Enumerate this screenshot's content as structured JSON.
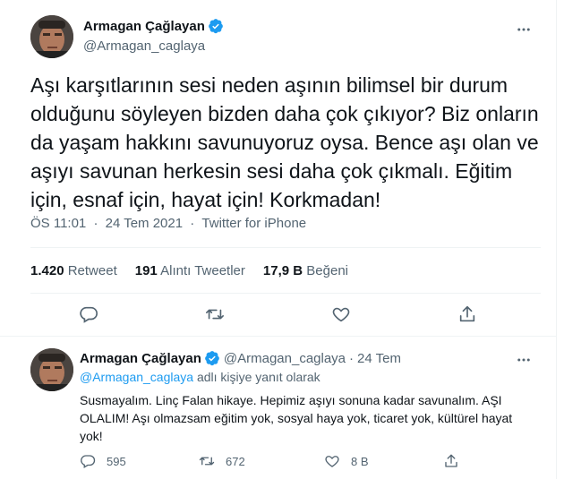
{
  "main_tweet": {
    "author_name": "Armagan Çağlayan",
    "author_handle": "@Armagan_caglaya",
    "text": "Aşı karşıtlarının sesi neden aşının bilimsel bir durum olduğunu söyleyen bizden daha çok çıkıyor? Biz onların da yaşam hakkını savunuyoruz oysa. Bence aşı olan ve aşıyı savunan herkesin sesi daha çok çıkmalı. Eğitim için, esnaf için, hayat için! Korkmadan!",
    "time": "ÖS 11:01",
    "date": "24 Tem 2021",
    "separator": "·",
    "source": "Twitter for iPhone",
    "retweets_count": "1.420",
    "retweets_label": "Retweet",
    "quotes_count": "191",
    "quotes_label": "Alıntı Tweetler",
    "likes_count": "17,9 B",
    "likes_label": "Beğeni"
  },
  "reply_tweet": {
    "author_name": "Armagan Çağlayan",
    "author_handle": "@Armagan_caglaya",
    "separator": "·",
    "date": "24 Tem",
    "replying_handle": "@Armagan_caglaya",
    "replying_suffix": "adlı kişiye yanıt olarak",
    "text": "Susmayalım. Linç Falan hikaye. Hepimiz aşıyı sonuna kadar savunalım. AŞI OLALIM! Aşı olmazsam eğitim yok, sosyal haya yok, ticaret yok, kültürel hayat yok!",
    "reply_count": "595",
    "retweet_count": "672",
    "like_count": "8 B"
  },
  "icons": {
    "verified": "verified-badge-icon",
    "more": "more-options-icon",
    "reply": "reply-icon",
    "retweet": "retweet-icon",
    "like": "heart-icon",
    "share": "share-icon"
  },
  "colors": {
    "accent": "#1d9bf0",
    "text": "#0f1419",
    "secondary": "#536471",
    "border": "#eff3f4"
  }
}
